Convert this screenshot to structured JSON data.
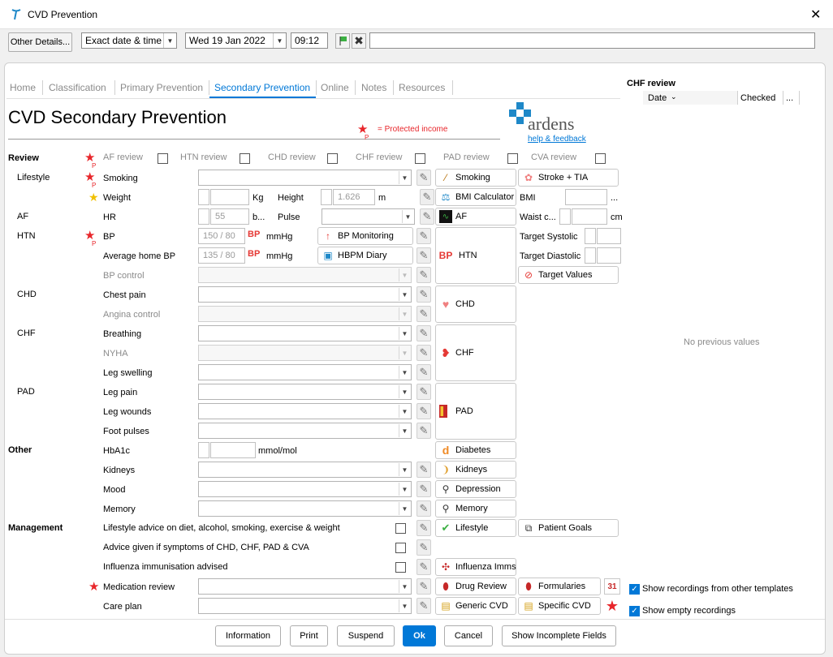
{
  "window": {
    "title": "CVD Prevention",
    "close": "✕"
  },
  "toolbar": {
    "other_details": "Other Details...",
    "date_mode": "Exact date & time",
    "date": "Wed 19 Jan 2022",
    "time": "09:12"
  },
  "tabs": [
    "Home",
    "Classification",
    "Primary Prevention",
    "Secondary Prevention",
    "Online",
    "Notes",
    "Resources"
  ],
  "page": {
    "title": "CVD Secondary Prevention",
    "protected_note": "= Protected income",
    "protected_mark": "P",
    "brand": "ardens",
    "help": "help & feedback"
  },
  "review": {
    "label": "Review",
    "items": [
      "AF review",
      "HTN review",
      "CHD review",
      "CHF review",
      "PAD review",
      "CVA review"
    ]
  },
  "sections": {
    "lifestyle": "Lifestyle",
    "af": "AF",
    "htn": "HTN",
    "chd": "CHD",
    "chf": "CHF",
    "pad": "PAD",
    "other": "Other",
    "management": "Management"
  },
  "fields": {
    "smoking": "Smoking",
    "weight": "Weight",
    "weight_unit": "Kg",
    "height": "Height",
    "height_val": "1.626",
    "height_unit": "m",
    "hr": "HR",
    "hr_val": "55",
    "hr_unit": "b...",
    "pulse": "Pulse",
    "bp": "BP",
    "bp_val": "150 / 80",
    "bp_unit": "mmHg",
    "avg_bp": "Average home BP",
    "avg_bp_val": "135 / 80",
    "bp_control": "BP control",
    "chest_pain": "Chest pain",
    "angina": "Angina control",
    "breathing": "Breathing",
    "nyha": "NYHA",
    "leg_swelling": "Leg swelling",
    "leg_pain": "Leg pain",
    "leg_wounds": "Leg wounds",
    "foot_pulses": "Foot pulses",
    "hba1c": "HbA1c",
    "hba1c_unit": "mmol/mol",
    "kidneys": "Kidneys",
    "mood": "Mood",
    "memory": "Memory",
    "mgmt1": "Lifestyle advice on diet, alcohol, smoking, exercise & weight",
    "mgmt2": "Advice given if symptoms of CHD, CHF, PAD & CVA",
    "mgmt3": "Influenza immunisation advised",
    "med_review": "Medication review",
    "care_plan": "Care plan",
    "bp_logo": "BP"
  },
  "side_buttons": {
    "smoking": "Smoking",
    "stroke": "Stroke + TIA",
    "bmi_calc": "BMI Calculator",
    "af": "AF",
    "bp_monitoring": "BP Monitoring",
    "hbpm": "HBPM Diary",
    "htn": "HTN",
    "chd": "CHD",
    "chf": "CHF",
    "pad": "PAD",
    "diabetes": "Diabetes",
    "kidneys": "Kidneys",
    "depression": "Depression",
    "memory": "Memory",
    "lifestyle": "Lifestyle",
    "patient_goals": "Patient Goals",
    "influenza": "Influenza Imms",
    "drug_review": "Drug Review",
    "formularies": "Formularies",
    "generic_cvd": "Generic CVD",
    "specific_cvd": "Specific CVD",
    "target_values": "Target Values"
  },
  "right_labels": {
    "bmi": "BMI",
    "bmi_more": "...",
    "waist": "Waist c...",
    "waist_unit": "cm",
    "target_sys": "Target Systolic",
    "target_dia": "Target Diastolic"
  },
  "chf_review": {
    "title": "CHF review",
    "col_date": "Date",
    "col_checked": "Checked",
    "col_more": "...",
    "empty": "No previous values"
  },
  "options": {
    "show_other": "Show recordings from other templates",
    "show_empty": "Show empty recordings"
  },
  "footer": {
    "information": "Information",
    "print": "Print",
    "suspend": "Suspend",
    "ok": "Ok",
    "cancel": "Cancel",
    "incomplete": "Show Incomplete Fields"
  },
  "colors": {
    "accent": "#0078d7",
    "protected": "#e8262b",
    "brand": "#1e88c8"
  }
}
